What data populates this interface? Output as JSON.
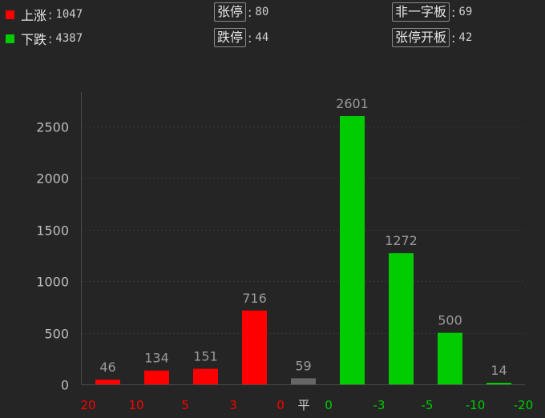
{
  "stats": {
    "up": {
      "label": "上涨",
      "value": "1047",
      "color": "#ff0000"
    },
    "down": {
      "label": "下跌",
      "value": "4387",
      "color": "#00cc00"
    },
    "limit_up": {
      "label": "张停",
      "value": "80"
    },
    "limit_down": {
      "label": "跌停",
      "value": "44"
    },
    "not_one_word": {
      "label": "非一字板",
      "value": "69"
    },
    "limit_up_opened": {
      "label": "张停开板",
      "value": "42"
    }
  },
  "chart_data": {
    "type": "bar",
    "ylim": [
      0,
      2800
    ],
    "yticks": [
      "0",
      "500",
      "1000",
      "1500",
      "2000",
      "2500"
    ],
    "ytick_values": [
      0,
      500,
      1000,
      1500,
      2000,
      2500
    ],
    "grid": "horizontal dashed",
    "bars": [
      {
        "value": 46,
        "label": "46",
        "color": "#ff0000"
      },
      {
        "value": 134,
        "label": "134",
        "color": "#ff0000"
      },
      {
        "value": 151,
        "label": "151",
        "color": "#ff0000"
      },
      {
        "value": 716,
        "label": "716",
        "color": "#ff0000"
      },
      {
        "value": 59,
        "label": "59",
        "color": "#666666"
      },
      {
        "value": 2601,
        "label": "2601",
        "color": "#00cc00"
      },
      {
        "value": 1272,
        "label": "1272",
        "color": "#00cc00"
      },
      {
        "value": 500,
        "label": "500",
        "color": "#00cc00"
      },
      {
        "value": 14,
        "label": "14",
        "color": "#00cc00"
      }
    ],
    "xticks": [
      {
        "label": "20",
        "color": "#ff0000"
      },
      {
        "label": "10",
        "color": "#ff0000"
      },
      {
        "label": "5",
        "color": "#ff0000"
      },
      {
        "label": "3",
        "color": "#ff0000"
      },
      {
        "label": "0",
        "color": "#ff0000"
      },
      {
        "label": "平",
        "color": "#cfcfcf"
      },
      {
        "label": "0",
        "color": "#00cc00"
      },
      {
        "label": "-3",
        "color": "#00cc00"
      },
      {
        "label": "-5",
        "color": "#00cc00"
      },
      {
        "label": "-10",
        "color": "#00cc00"
      },
      {
        "label": "-20",
        "color": "#00cc00"
      }
    ]
  }
}
